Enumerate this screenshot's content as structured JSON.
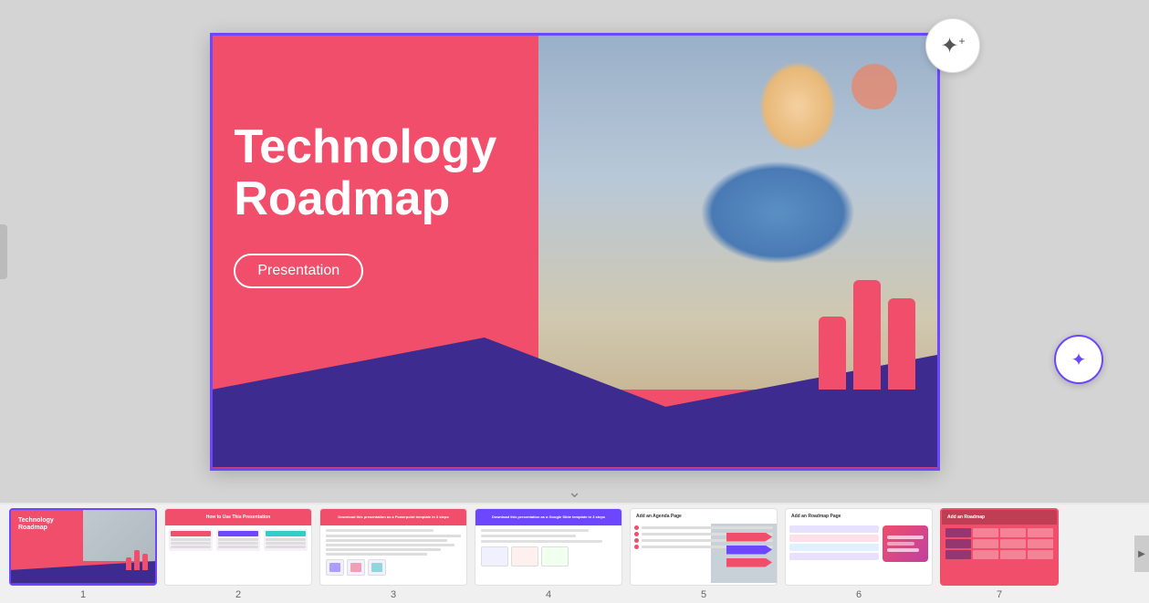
{
  "app": {
    "title": "Technology Roadmap Presentation"
  },
  "main_slide": {
    "title": "Technology Roadmap",
    "subtitle_btn": "Presentation",
    "bg_color": "#f04e6a",
    "accent_color": "#3d2b8f"
  },
  "ai_button": {
    "icon": "✦+",
    "label": "AI Generate"
  },
  "magic_button": {
    "icon": "✦",
    "label": "Magic Tools"
  },
  "scroll_handle": {
    "icon": "⌄"
  },
  "strip_arrow_right": {
    "icon": "▶"
  },
  "thumbnails": [
    {
      "num": "1",
      "label": "Technology Roadmap",
      "active": true
    },
    {
      "num": "2",
      "label": "How to Use This Presentation",
      "active": false
    },
    {
      "num": "3",
      "label": "Download this presentation as a Powerpoint template in 3 steps",
      "active": false
    },
    {
      "num": "4",
      "label": "Download this presentation as a Google Slide template in 3 steps",
      "active": false
    },
    {
      "num": "5",
      "label": "Add an Agenda Page",
      "active": false
    },
    {
      "num": "6",
      "label": "Add an Roadmap Page",
      "active": false
    },
    {
      "num": "7",
      "label": "Add an Roadmap",
      "active": false
    }
  ]
}
